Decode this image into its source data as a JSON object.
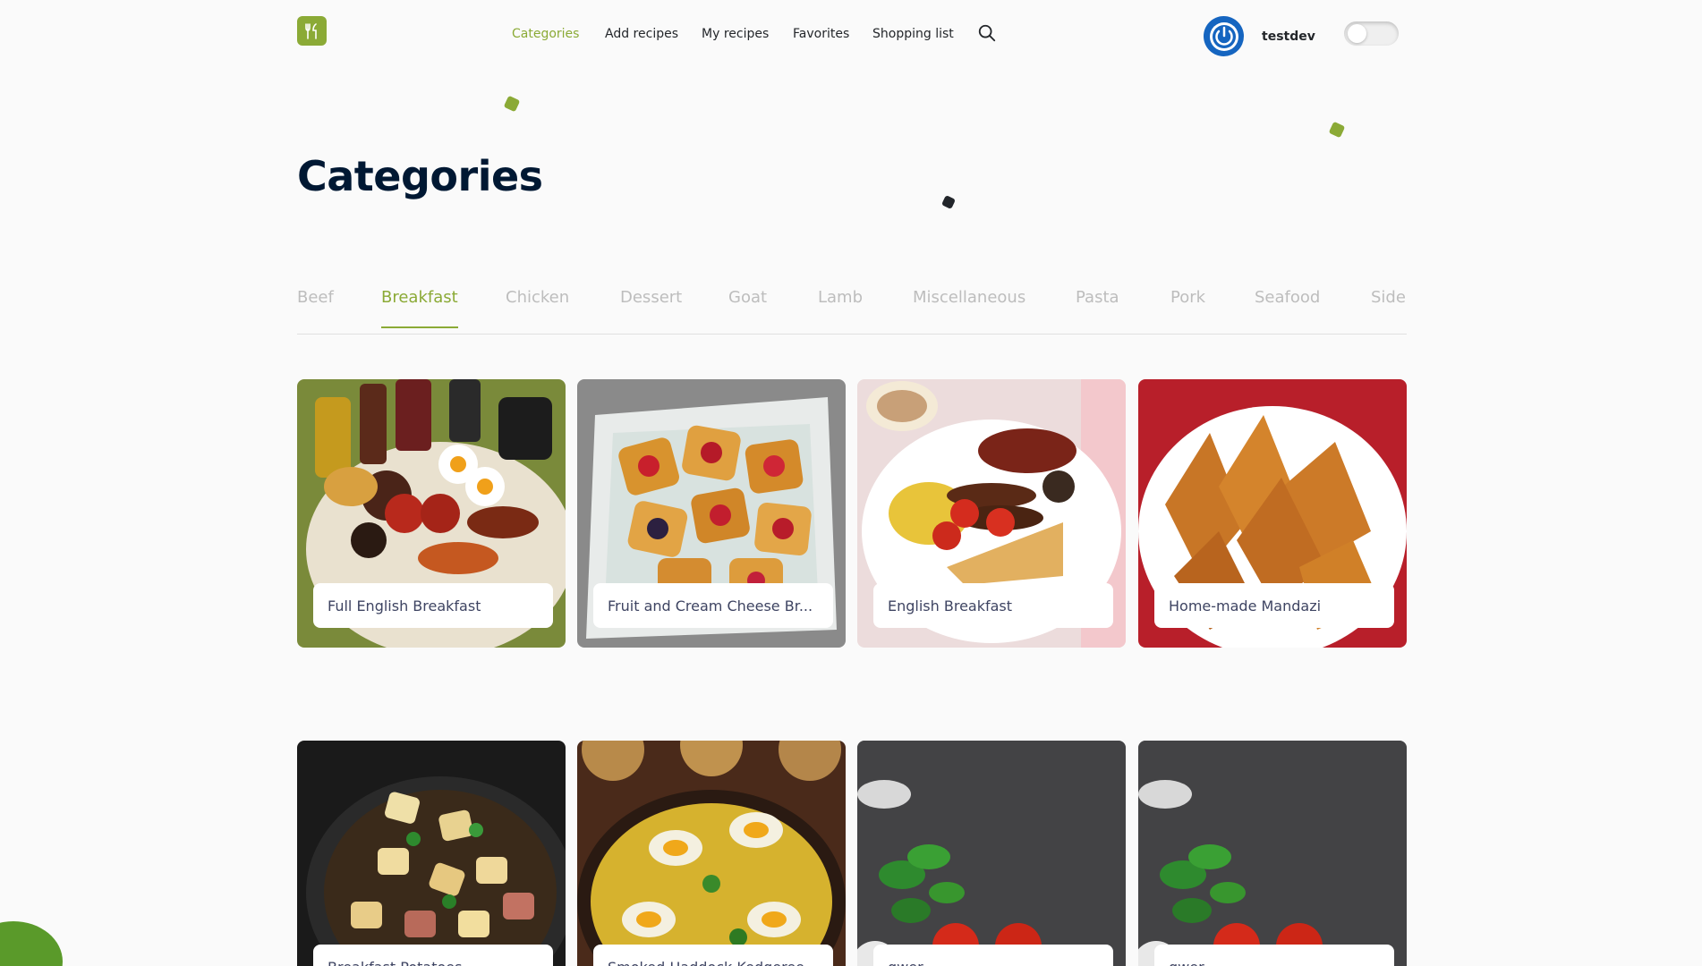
{
  "header": {
    "logo_icon": "fork-knife-icon",
    "nav": [
      "Categories",
      "Add recipes",
      "My recipes",
      "Favorites",
      "Shopping list"
    ],
    "active_nav": "Categories",
    "search_icon": "search-icon",
    "username": "testdev",
    "avatar_icon": "power-icon",
    "theme_toggle": "off"
  },
  "page": {
    "title": "Categories"
  },
  "tabs": {
    "items": [
      "Beef",
      "Breakfast",
      "Chicken",
      "Dessert",
      "Goat",
      "Lamb",
      "Miscellaneous",
      "Pasta",
      "Pork",
      "Seafood",
      "Side"
    ],
    "active": "Breakfast"
  },
  "recipes": [
    {
      "title": "Full English Breakfast"
    },
    {
      "title": "Fruit and Cream Cheese Br..."
    },
    {
      "title": "English Breakfast"
    },
    {
      "title": "Home-made Mandazi"
    },
    {
      "title": "Breakfast Potatoes"
    },
    {
      "title": "Smoked Haddock Kedgeree"
    },
    {
      "title": "qwer"
    },
    {
      "title": "qwer"
    }
  ],
  "colors": {
    "accent": "#8baa36",
    "title": "#001833",
    "tab_inactive": "#bdbdbd",
    "avatar": "#1565c0"
  }
}
